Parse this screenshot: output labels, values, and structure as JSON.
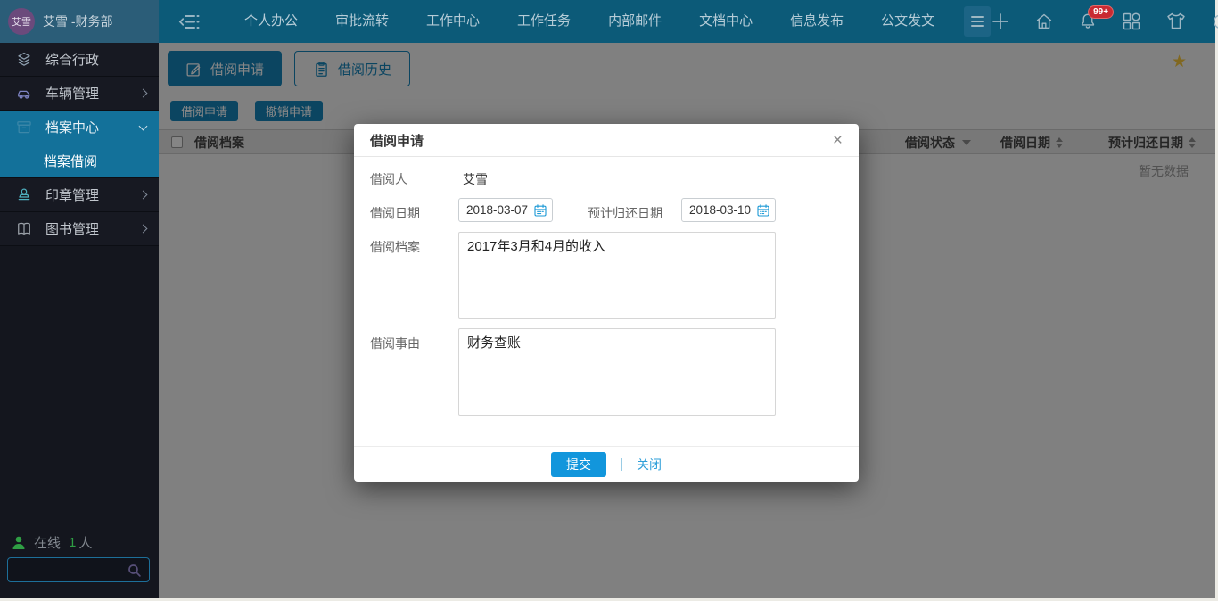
{
  "colors": {
    "navbar": "#0c5a78",
    "userblock": "#2b5d78",
    "avatar": "#6b4a7c",
    "sidebar": "#14161e",
    "sidebar_active": "#13719a",
    "accent": "#1583b8",
    "submit": "#1296dc",
    "badge": "#c92a32",
    "star": "#f3c53e",
    "online_green": "#2f9e44"
  },
  "topbar": {
    "avatar_text": "艾雪",
    "user_name": "艾雪 -财务部",
    "nav_items": [
      {
        "label": "个人办公"
      },
      {
        "label": "审批流转"
      },
      {
        "label": "工作中心"
      },
      {
        "label": "工作任务"
      },
      {
        "label": "内部邮件"
      },
      {
        "label": "文档中心"
      },
      {
        "label": "信息发布"
      },
      {
        "label": "公文发文"
      }
    ],
    "notification_badge": "99+"
  },
  "sidebar": {
    "items": [
      {
        "label": "综合行政"
      },
      {
        "label": "车辆管理"
      },
      {
        "label": "档案中心"
      },
      {
        "label": "档案借阅"
      },
      {
        "label": "印章管理"
      },
      {
        "label": "图书管理"
      }
    ],
    "online_label": "在线",
    "online_count": "1",
    "online_suffix": "人"
  },
  "content": {
    "tabs": [
      {
        "label": "借阅申请"
      },
      {
        "label": "借阅历史"
      }
    ],
    "actions": [
      {
        "label": "借阅申请"
      },
      {
        "label": "撤销申请"
      }
    ],
    "table": {
      "col_archive": "借阅档案",
      "col_status": "借阅状态",
      "col_date": "借阅日期",
      "col_return": "预计归还日期",
      "empty_text": "暂无数据"
    },
    "star_glyph": "★"
  },
  "modal": {
    "title": "借阅申请",
    "close_glyph": "×",
    "fields": {
      "borrower_label": "借阅人",
      "borrower_value": "艾雪",
      "date_label": "借阅日期",
      "date_value": "2018-03-07",
      "return_label": "预计归还日期",
      "return_value": "2018-03-10",
      "archive_label": "借阅档案",
      "archive_value": "2017年3月和4月的收入",
      "reason_label": "借阅事由",
      "reason_value": "财务查账"
    },
    "submit_label": "提交",
    "separator_glyph": "|",
    "close_label": "关闭"
  }
}
